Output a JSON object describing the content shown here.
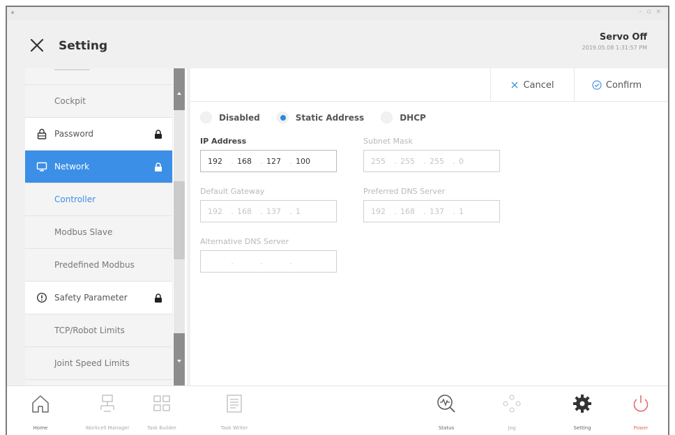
{
  "header": {
    "title": "Setting",
    "servo_status": "Servo Off",
    "timestamp": "2019.05.08 1:31:57 PM"
  },
  "sidebar": {
    "items": [
      {
        "label": "Cockpit"
      },
      {
        "label": "Password"
      },
      {
        "label": "Network"
      },
      {
        "label": "Controller"
      },
      {
        "label": "Modbus Slave"
      },
      {
        "label": "Predefined Modbus"
      },
      {
        "label": "Safety Parameter"
      },
      {
        "label": "TCP/Robot Limits"
      },
      {
        "label": "Joint Speed Limits"
      }
    ]
  },
  "actions": {
    "cancel_label": "Cancel",
    "confirm_label": "Confirm"
  },
  "network": {
    "mode_options": [
      "Disabled",
      "Static Address",
      "DHCP"
    ],
    "selected_mode": "Static Address",
    "ip_address": {
      "label": "IP Address",
      "octets": [
        "192",
        "168",
        "127",
        "100"
      ]
    },
    "subnet_mask": {
      "label": "Subnet Mask",
      "octets": [
        "255",
        "255",
        "255",
        "0"
      ]
    },
    "default_gateway": {
      "label": "Default Gateway",
      "octets": [
        "192",
        "168",
        "137",
        "1"
      ]
    },
    "preferred_dns": {
      "label": "Preferred DNS Server",
      "octets": [
        "192",
        "168",
        "137",
        "1"
      ]
    },
    "alternative_dns": {
      "label": "Alternative DNS Server",
      "octets": [
        "",
        "",
        "",
        ""
      ]
    }
  },
  "bottombar": {
    "items": [
      {
        "label": "Home"
      },
      {
        "label": "Workcell Manager"
      },
      {
        "label": "Task Builder"
      },
      {
        "label": "Task Writer"
      },
      {
        "label": "Status"
      },
      {
        "label": "Jog"
      },
      {
        "label": "Setting"
      },
      {
        "label": "Power"
      }
    ]
  },
  "colors": {
    "accent": "#3b8fe6",
    "power": "#e56b6b",
    "panel_bg": "#f0f0f0"
  }
}
